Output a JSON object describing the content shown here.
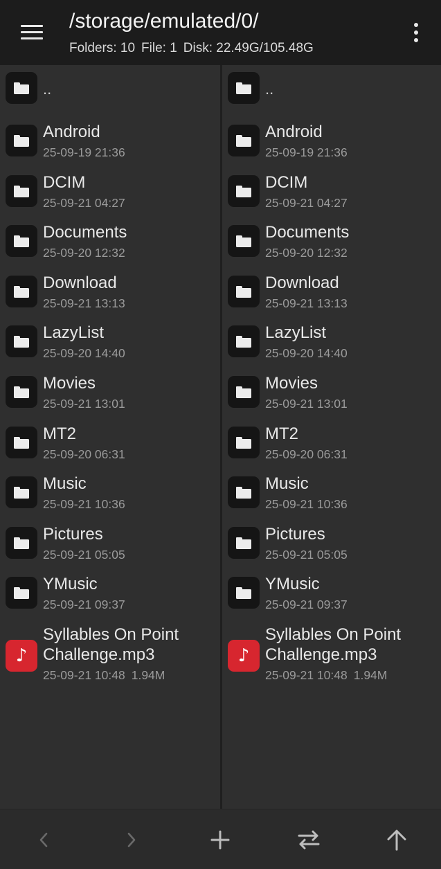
{
  "header": {
    "path": "/storage/emulated/0/",
    "folders": "Folders: 10",
    "files": "File: 1",
    "disk": "Disk: 22.49G/105.48G",
    "menu_icon": "hamburger-menu-icon",
    "more_icon": "more-vert-icon"
  },
  "panes": {
    "left": {
      "up_label": "..",
      "items": [
        {
          "name": "Android",
          "date": "25-09-19 21:36",
          "icon": "folder-icon"
        },
        {
          "name": "DCIM",
          "date": "25-09-21 04:27",
          "icon": "folder-icon"
        },
        {
          "name": "Documents",
          "date": "25-09-20 12:32",
          "icon": "folder-icon"
        },
        {
          "name": "Download",
          "date": "25-09-21 13:13",
          "icon": "folder-icon"
        },
        {
          "name": "LazyList",
          "date": "25-09-20 14:40",
          "icon": "folder-icon"
        },
        {
          "name": "Movies",
          "date": "25-09-21 13:01",
          "icon": "folder-icon"
        },
        {
          "name": "MT2",
          "date": "25-09-20 06:31",
          "icon": "folder-icon"
        },
        {
          "name": "Music",
          "date": "25-09-21 10:36",
          "icon": "folder-icon"
        },
        {
          "name": "Pictures",
          "date": "25-09-21 05:05",
          "icon": "folder-icon"
        },
        {
          "name": "YMusic",
          "date": "25-09-21 09:37",
          "icon": "folder-icon"
        }
      ],
      "file": {
        "name_line1": "Syllables On Point",
        "name_line2": "Challenge.mp3",
        "date": "25-09-21 10:48",
        "size": "1.94M",
        "icon": "music-file-icon",
        "icon_color": "#d7262f"
      }
    },
    "right": {
      "up_label": "..",
      "items": [
        {
          "name": "Android",
          "date": "25-09-19 21:36",
          "icon": "folder-icon"
        },
        {
          "name": "DCIM",
          "date": "25-09-21 04:27",
          "icon": "folder-icon"
        },
        {
          "name": "Documents",
          "date": "25-09-20 12:32",
          "icon": "folder-icon"
        },
        {
          "name": "Download",
          "date": "25-09-21 13:13",
          "icon": "folder-icon"
        },
        {
          "name": "LazyList",
          "date": "25-09-20 14:40",
          "icon": "folder-icon"
        },
        {
          "name": "Movies",
          "date": "25-09-21 13:01",
          "icon": "folder-icon"
        },
        {
          "name": "MT2",
          "date": "25-09-20 06:31",
          "icon": "folder-icon"
        },
        {
          "name": "Music",
          "date": "25-09-21 10:36",
          "icon": "folder-icon"
        },
        {
          "name": "Pictures",
          "date": "25-09-21 05:05",
          "icon": "folder-icon"
        },
        {
          "name": "YMusic",
          "date": "25-09-21 09:37",
          "icon": "folder-icon"
        }
      ],
      "file": {
        "name_line1": "Syllables On Point",
        "name_line2": "Challenge.mp3",
        "date": "25-09-21 10:48",
        "size": "1.94M",
        "icon": "music-file-icon",
        "icon_color": "#d7262f"
      }
    }
  },
  "toolbar": {
    "back_icon": "chevron-left-icon",
    "forward_icon": "chevron-right-icon",
    "add_icon": "plus-icon",
    "swap_icon": "swap-arrows-icon",
    "up_icon": "arrow-up-icon"
  },
  "colors": {
    "topbar_bg": "#1c1c1c",
    "pane_bg": "#2f2f2f",
    "icon_bg": "#151515",
    "music_accent": "#d7262f",
    "meta_text": "#9a9a9a"
  }
}
